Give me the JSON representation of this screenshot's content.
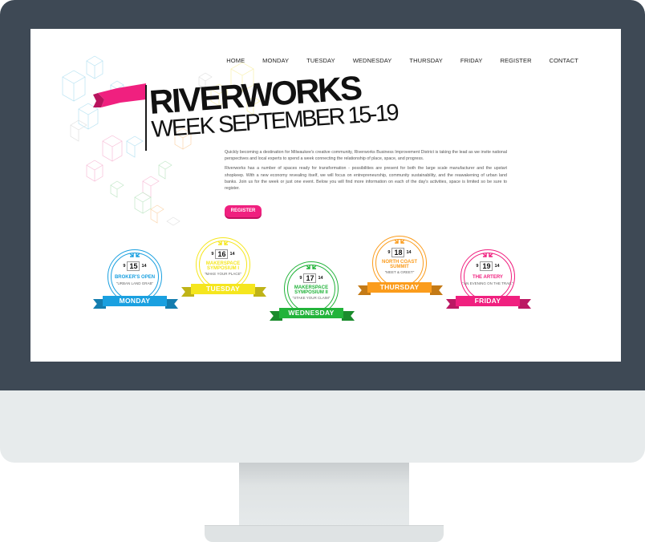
{
  "nav": {
    "items": [
      {
        "label": "HOME",
        "id": "home"
      },
      {
        "label": "MONDAY",
        "id": "monday"
      },
      {
        "label": "TUESDAY",
        "id": "tuesday"
      },
      {
        "label": "WEDNESDAY",
        "id": "wednesday"
      },
      {
        "label": "THURSDAY",
        "id": "thursday"
      },
      {
        "label": "FRIDAY",
        "id": "friday"
      },
      {
        "label": "REGISTER",
        "id": "register"
      },
      {
        "label": "CONTACT",
        "id": "contact"
      }
    ]
  },
  "hero": {
    "title_line1": "RIVERWORKS",
    "title_week": "WEEK",
    "title_date": "SEPTEMBER 15-19",
    "paragraph1": "Quickly becoming a destination for Milwaukee's creative community, Riverworks Business Improvement District is taking the lead as we invite national perspectives and local experts to spend a week connecting the relationship of place, space, and progress.",
    "paragraph2": "Riverworks has a number of spaces ready for transformation - possibilities are present for both the large scale manufacturer and the upstart shopkeep. With a new economy revealing itself, we will focus on entrepreneurship, community sustainability, and the reawakening of urban land banks. Join us for the week or just one event. Below you will find more information on each of the day's activities, space is limited so be sure to register.",
    "register_label": "REGISTER"
  },
  "badges": [
    {
      "month": "9",
      "day": "15",
      "year": "14",
      "name_line1": "BROKER'S OPEN",
      "name_line2": "",
      "subtitle": "\"URBAN LAND GRAB\"",
      "ribbon": "MONDAY",
      "color": "#1aa0e0"
    },
    {
      "month": "9",
      "day": "16",
      "year": "14",
      "name_line1": "MAKERSPACE",
      "name_line2": "SYMPOSIUM I",
      "subtitle": "\"MAKE YOUR PLACE\"",
      "ribbon": "TUESDAY",
      "color": "#f5e61e"
    },
    {
      "month": "9",
      "day": "17",
      "year": "14",
      "name_line1": "MAKERSPACE",
      "name_line2": "SYMPOSIUM II",
      "subtitle": "\"STAKE YOUR CLAIM\"",
      "ribbon": "WEDNESDAY",
      "color": "#22b33a"
    },
    {
      "month": "9",
      "day": "18",
      "year": "14",
      "name_line1": "NORTH COAST",
      "name_line2": "SUMMIT",
      "subtitle": "\"MEET & GREET\"",
      "ribbon": "THURSDAY",
      "color": "#fb9c1c"
    },
    {
      "month": "9",
      "day": "19",
      "year": "14",
      "name_line1": "THE ARTERY",
      "name_line2": "",
      "subtitle": "\"AN EVENING ON THE TRAIL\"",
      "ribbon": "FRIDAY",
      "color": "#f0207f"
    }
  ],
  "colors": {
    "bezel": "#3e4955",
    "accent": "#f0207f"
  }
}
